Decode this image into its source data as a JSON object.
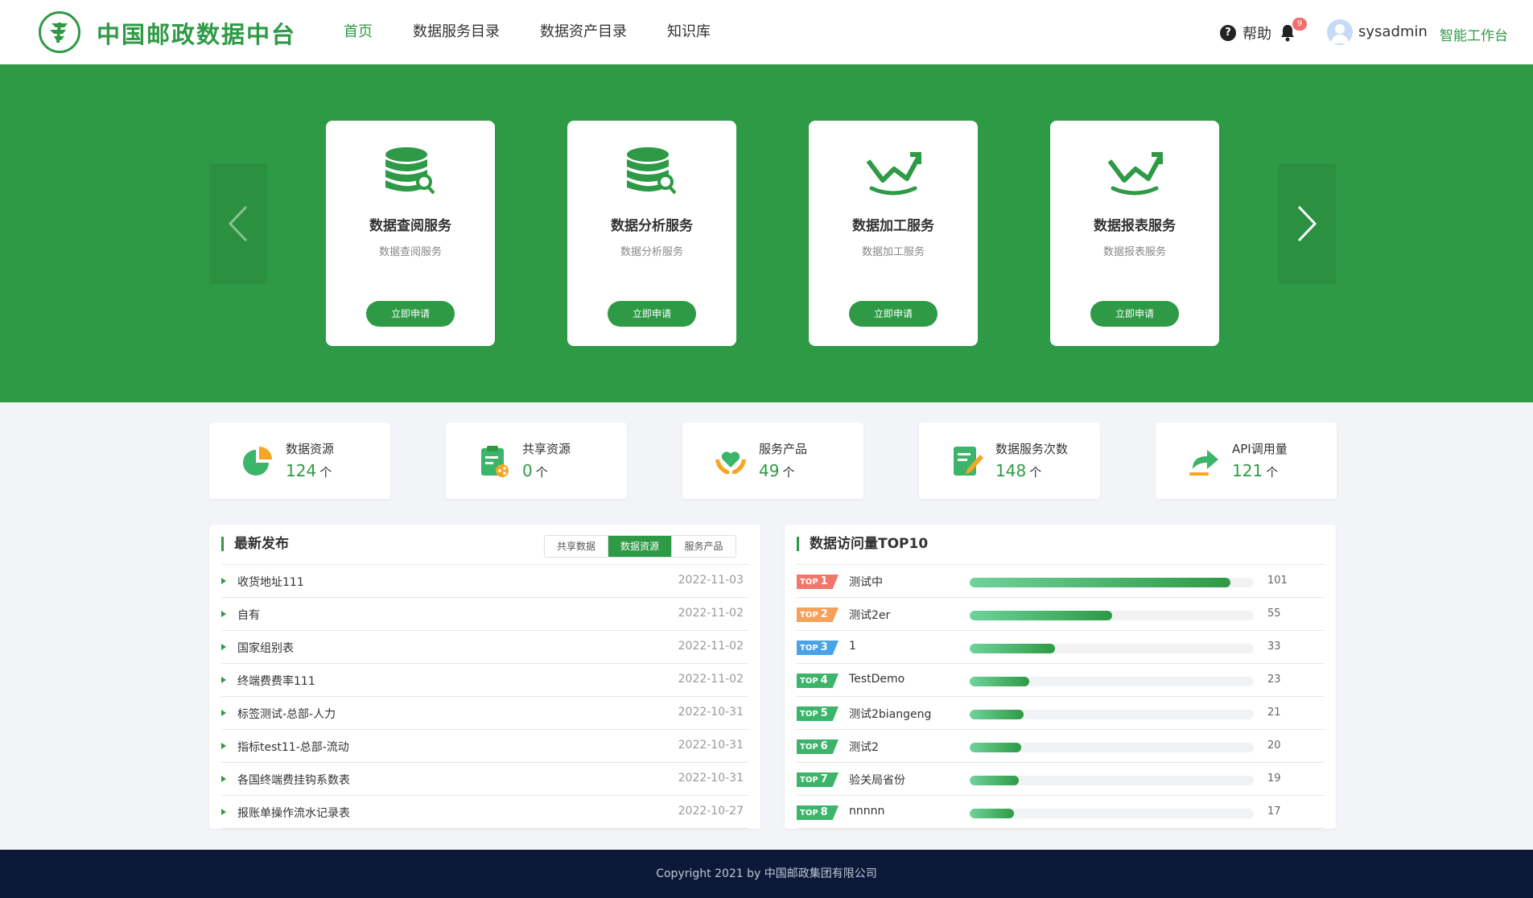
{
  "header": {
    "brand": "中国邮政数据中台",
    "nav": [
      {
        "label": "首页",
        "active": true
      },
      {
        "label": "数据服务目录",
        "active": false
      },
      {
        "label": "数据资产目录",
        "active": false
      },
      {
        "label": "知识库",
        "active": false
      }
    ],
    "help_icon": "?",
    "help": "帮助",
    "notification_count": "9",
    "username": "sysadmin",
    "workbench": "智能工作台"
  },
  "services": [
    {
      "title": "数据查阅服务",
      "desc": "数据查阅服务",
      "button": "立即申请",
      "icon": "database-search-icon"
    },
    {
      "title": "数据分析服务",
      "desc": "数据分析服务",
      "button": "立即申请",
      "icon": "database-search-icon"
    },
    {
      "title": "数据加工服务",
      "desc": "数据加工服务",
      "button": "立即申请",
      "icon": "trend-up-icon"
    },
    {
      "title": "数据报表服务",
      "desc": "数据报表服务",
      "button": "立即申请",
      "icon": "trend-up-icon"
    }
  ],
  "stats": [
    {
      "label": "数据资源",
      "value": "124",
      "unit": "个",
      "icon": "pie-chart-icon"
    },
    {
      "label": "共享资源",
      "value": "0",
      "unit": "个",
      "icon": "clipboard-share-icon"
    },
    {
      "label": "服务产品",
      "value": "49",
      "unit": "个",
      "icon": "heart-hands-icon"
    },
    {
      "label": "数据服务次数",
      "value": "148",
      "unit": "个",
      "icon": "document-edit-icon"
    },
    {
      "label": "API调用量",
      "value": "121",
      "unit": "个",
      "icon": "share-arrow-icon"
    }
  ],
  "latest": {
    "title": "最新发布",
    "tabs": [
      {
        "label": "共享数据",
        "active": false
      },
      {
        "label": "数据资源",
        "active": true
      },
      {
        "label": "服务产品",
        "active": false
      }
    ],
    "items": [
      {
        "title": "收货地址111",
        "date": "2022-11-03"
      },
      {
        "title": "自有",
        "date": "2022-11-02"
      },
      {
        "title": "国家组别表",
        "date": "2022-11-02"
      },
      {
        "title": "终端费费率111",
        "date": "2022-11-02"
      },
      {
        "title": "标签测试-总部-人力",
        "date": "2022-10-31"
      },
      {
        "title": "指标test11-总部-流动",
        "date": "2022-10-31"
      },
      {
        "title": "各国终端费挂钩系数表",
        "date": "2022-10-31"
      },
      {
        "title": "报账单操作流水记录表",
        "date": "2022-10-27"
      }
    ]
  },
  "top10": {
    "title": "数据访问量TOP10",
    "prefix": "TOP",
    "max": 110,
    "items": [
      {
        "rank": "1",
        "name": "测试中",
        "value": 101,
        "color": "#f0776c"
      },
      {
        "rank": "2",
        "name": "测试2er",
        "value": 55,
        "color": "#f5a15a"
      },
      {
        "rank": "3",
        "name": "1",
        "value": 33,
        "color": "#4aa3e8"
      },
      {
        "rank": "4",
        "name": "TestDemo",
        "value": 23,
        "color": "#3cb46a"
      },
      {
        "rank": "5",
        "name": "测试2biangeng",
        "value": 21,
        "color": "#3cb46a"
      },
      {
        "rank": "6",
        "name": "测试2",
        "value": 20,
        "color": "#3cb46a"
      },
      {
        "rank": "7",
        "name": "验关局省份",
        "value": 19,
        "color": "#3cb46a"
      },
      {
        "rank": "8",
        "name": "nnnnn",
        "value": 17,
        "color": "#3cb46a"
      }
    ]
  },
  "footer": "Copyright 2021 by 中国邮政集团有限公司",
  "colors": {
    "primary": "#2e9a45",
    "footer_bg": "#0c1838"
  }
}
